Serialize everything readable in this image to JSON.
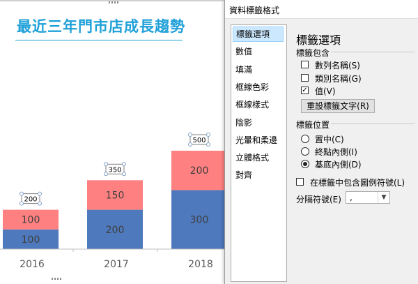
{
  "chart_data": {
    "type": "bar",
    "stacked": true,
    "title": "最近三年門市店成長趨勢",
    "categories": [
      "2016",
      "2017",
      "2018"
    ],
    "series": [
      {
        "values": [
          100,
          200,
          300
        ],
        "color": "#4e79bd"
      },
      {
        "values": [
          100,
          150,
          200
        ],
        "color": "#ff8080"
      }
    ],
    "totals": [
      200,
      350,
      500
    ],
    "ylim": [
      0,
      500
    ],
    "grid": false,
    "legend": "none"
  },
  "dialog": {
    "title": "資料標籤格式",
    "nav": [
      "標籤選項",
      "數值",
      "填滿",
      "框線色彩",
      "框線樣式",
      "陰影",
      "光暈和柔邊",
      "立體格式",
      "對齊"
    ],
    "selected_nav": 0,
    "panel_title": "標籤選項",
    "contains_label": "標籤包含",
    "contains": [
      {
        "label": "數列名稱(S)",
        "checked": false
      },
      {
        "label": "類別名稱(G)",
        "checked": false
      },
      {
        "label": "值(V)",
        "checked": true
      }
    ],
    "reset_button": "重設標籤文字(R)",
    "position_label": "標籤位置",
    "positions": [
      {
        "label": "置中(C)",
        "selected": false
      },
      {
        "label": "終點內側(I)",
        "selected": false
      },
      {
        "label": "基底內側(D)",
        "selected": true
      }
    ],
    "legend_key_label": "在標籤中包含圖例符號(L)",
    "legend_key_checked": false,
    "separator_label": "分隔符號(E)",
    "separator_value": ","
  },
  "icons": {
    "checkmark": "check-icon",
    "dropdown": "chevron-down-icon"
  }
}
